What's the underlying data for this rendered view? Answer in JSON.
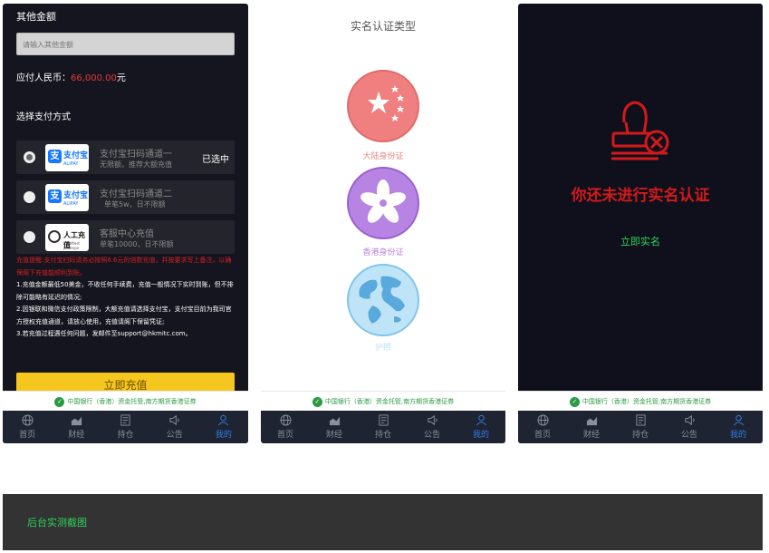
{
  "recharge": {
    "other_amount_title": "其他金额",
    "other_amount_placeholder": "请输入其他金额",
    "payable_label": "应付人民币：",
    "payable_amount": "66,000.00",
    "payable_unit": "元",
    "method_title": "选择支付方式",
    "options": [
      {
        "name": "支付宝扫码通道一",
        "desc": "无限额，推荐大额充值",
        "selected_label": "已选中",
        "logo_text": "支付宝",
        "logo_sub": "ALIPAY"
      },
      {
        "name": "支付宝扫码通道二",
        "desc": "单笔5w，日不限额",
        "logo_text": "支付宝",
        "logo_sub": "ALIPAY"
      },
      {
        "name": "客服中心充值",
        "desc": "单笔10000，日不限额",
        "logo_text": "人工充值",
        "logo_sub": "Kmeftest Jastevpe"
      }
    ],
    "notice_red": "充值提醒:支付宝扫码请务必按照6.6元的倍数充值，并按要求写上备注，以确保阁下充值能顺利到账。",
    "notice_1": "1.充值金额最低50美金，不收任何手续费，充值一般情况下实时到账，但不排除可能略有延迟的情况;",
    "notice_2": "2.因银联和微信支付政策限制，大额充值请选择支付宝，支付宝目前为我司官方授权充值通道，请放心使用，充值请阁下保留凭证;",
    "notice_3": "3.若充值过程遇任何问题，发邮件至support@hkmitc.com。",
    "submit_label": "立即充值"
  },
  "id_types": {
    "title": "实名认证类型",
    "mainland": "大陆身份证",
    "hongkong": "香港身份证",
    "passport": "护照"
  },
  "unverified": {
    "message": "你还未进行实名认证",
    "action": "立即实名"
  },
  "bank_banner": "中国银行（香港）资金托管,南方期货香港证券",
  "nav": [
    "首页",
    "财经",
    "持仓",
    "公告",
    "我的"
  ],
  "footer": "后台实测截图",
  "colors": {
    "accent_red": "#d21a1a",
    "accent_green": "#2bd45a",
    "button_yellow": "#f5c71e",
    "nav_active": "#2f7ee6"
  }
}
